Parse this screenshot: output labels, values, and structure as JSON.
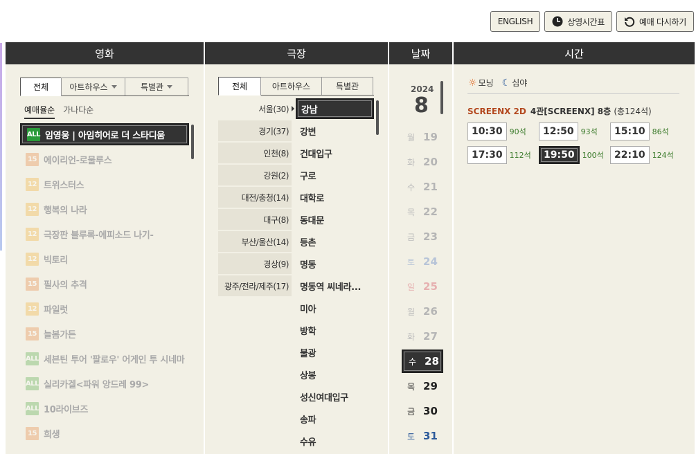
{
  "top_buttons": {
    "english": "ENGLISH",
    "timetable": "상영시간표",
    "reset": "예매 다시하기"
  },
  "headers": {
    "movie": "영화",
    "theater": "극장",
    "date": "날짜",
    "time": "시간"
  },
  "movie_tabs": {
    "all": "전체",
    "arthouse": "아트하우스",
    "special": "특별관"
  },
  "movie_sort": {
    "booking": "예매율순",
    "name": "가나다순"
  },
  "movies": [
    {
      "rating": "ALL",
      "title": "임영웅 | 아임히어로 더 스타디움"
    },
    {
      "rating": "15",
      "title": "에이리언-로물루스"
    },
    {
      "rating": "12",
      "title": "트위스터스"
    },
    {
      "rating": "12",
      "title": "행복의 나라"
    },
    {
      "rating": "12",
      "title": "극장판 블루록-에피소드 나기-"
    },
    {
      "rating": "12",
      "title": "빅토리"
    },
    {
      "rating": "15",
      "title": "필사의 추격"
    },
    {
      "rating": "12",
      "title": "파일럿"
    },
    {
      "rating": "15",
      "title": "늘봄가든"
    },
    {
      "rating": "ALL",
      "title": "세븐틴 투어 '팔로우' 어게인 투 시네마"
    },
    {
      "rating": "ALL",
      "title": "실리카겔<파워 앙드레 99>"
    },
    {
      "rating": "ALL",
      "title": "10라이브즈"
    },
    {
      "rating": "15",
      "title": "희생"
    }
  ],
  "theater_tabs": {
    "all": "전체",
    "arthouse": "아트하우스",
    "special": "특별관"
  },
  "regions": [
    "서울(30)",
    "경기(37)",
    "인천(8)",
    "강원(2)",
    "대전/충청(14)",
    "대구(8)",
    "부산/울산(14)",
    "경상(9)",
    "광주/전라/제주(17)"
  ],
  "theaters": [
    "강남",
    "강변",
    "건대입구",
    "구로",
    "대학로",
    "동대문",
    "등촌",
    "명동",
    "명동역 씨네라...",
    "미아",
    "방학",
    "불광",
    "상봉",
    "성신여대입구",
    "송파",
    "수유"
  ],
  "date": {
    "year": "2024",
    "month": "8"
  },
  "days": [
    {
      "dow": "월",
      "d": "19"
    },
    {
      "dow": "화",
      "d": "20"
    },
    {
      "dow": "수",
      "d": "21"
    },
    {
      "dow": "목",
      "d": "22"
    },
    {
      "dow": "금",
      "d": "23"
    },
    {
      "dow": "토",
      "d": "24"
    },
    {
      "dow": "일",
      "d": "25"
    },
    {
      "dow": "월",
      "d": "26"
    },
    {
      "dow": "화",
      "d": "27"
    },
    {
      "dow": "수",
      "d": "28"
    },
    {
      "dow": "목",
      "d": "29"
    },
    {
      "dow": "금",
      "d": "30"
    },
    {
      "dow": "토",
      "d": "31"
    }
  ],
  "time_filter": {
    "morning": "모닝",
    "night": "심야"
  },
  "screen": {
    "type": "SCREENX 2D",
    "name": "4관[SCREENX] 8층",
    "total": "(총124석)"
  },
  "showtimes": [
    {
      "time": "10:30",
      "seats": "90석"
    },
    {
      "time": "12:50",
      "seats": "93석"
    },
    {
      "time": "15:10",
      "seats": "86석"
    },
    {
      "time": "17:30",
      "seats": "112석"
    },
    {
      "time": "19:50",
      "seats": "100석"
    },
    {
      "time": "22:10",
      "seats": "124석"
    }
  ]
}
